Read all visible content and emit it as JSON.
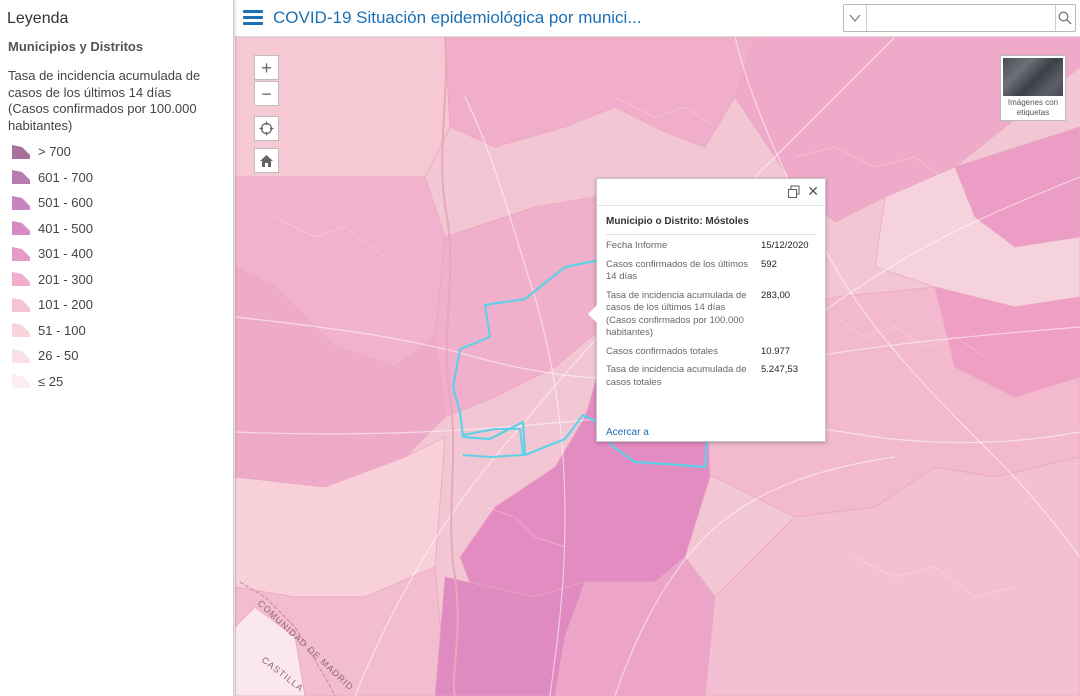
{
  "legend": {
    "title": "Leyenda",
    "layer_title": "Municipios y Distritos",
    "description": "Tasa de incidencia acumulada de casos de los últimos 14 días (Casos confirmados por 100.000 habitantes)",
    "classes": [
      {
        "label": "> 700",
        "color": "#a9709a"
      },
      {
        "label": "601 - 700",
        "color": "#b67bb0"
      },
      {
        "label": "501 - 600",
        "color": "#c784bf"
      },
      {
        "label": "401 - 500",
        "color": "#d68cc2"
      },
      {
        "label": "301 - 400",
        "color": "#e79ac8"
      },
      {
        "label": "201 - 300",
        "color": "#f0adcd"
      },
      {
        "label": "101 - 200",
        "color": "#f5c3d3"
      },
      {
        "label": "51 - 100",
        "color": "#f8d4dc"
      },
      {
        "label": "26 - 50",
        "color": "#fbe1e7"
      },
      {
        "label": "≤ 25",
        "color": "#fdeef2"
      }
    ]
  },
  "header": {
    "title": "COVID-19 Situación epidemiológica por munici...",
    "search_placeholder": ""
  },
  "map": {
    "zoom_in_label": "+",
    "zoom_out_label": "−",
    "basemap_label": "Imágenes con etiquetas",
    "region_label_1": "COMUNIDAD DE MADRID",
    "region_label_2": "CASTILLA"
  },
  "popup": {
    "title": "Municipio o Distrito: Móstoles",
    "fields": [
      {
        "label": "Fecha Informe",
        "value": "15/12/2020"
      },
      {
        "label": "Casos confirmados de los últimos 14 días",
        "value": "592"
      },
      {
        "label": "Tasa de incidencia acumulada de casos de los últimos 14 días (Casos confirmados por 100.000 habitantes)",
        "value": "283,00"
      },
      {
        "label": "Casos confirmados totales",
        "value": "10.977"
      },
      {
        "label": "Tasa de incidencia acumulada de casos totales",
        "value": "5.247,53"
      }
    ],
    "zoom_link": "Acercar a"
  },
  "colors": {
    "accent": "#1b6fb4",
    "highlight_outline": "#5ed1e8"
  }
}
